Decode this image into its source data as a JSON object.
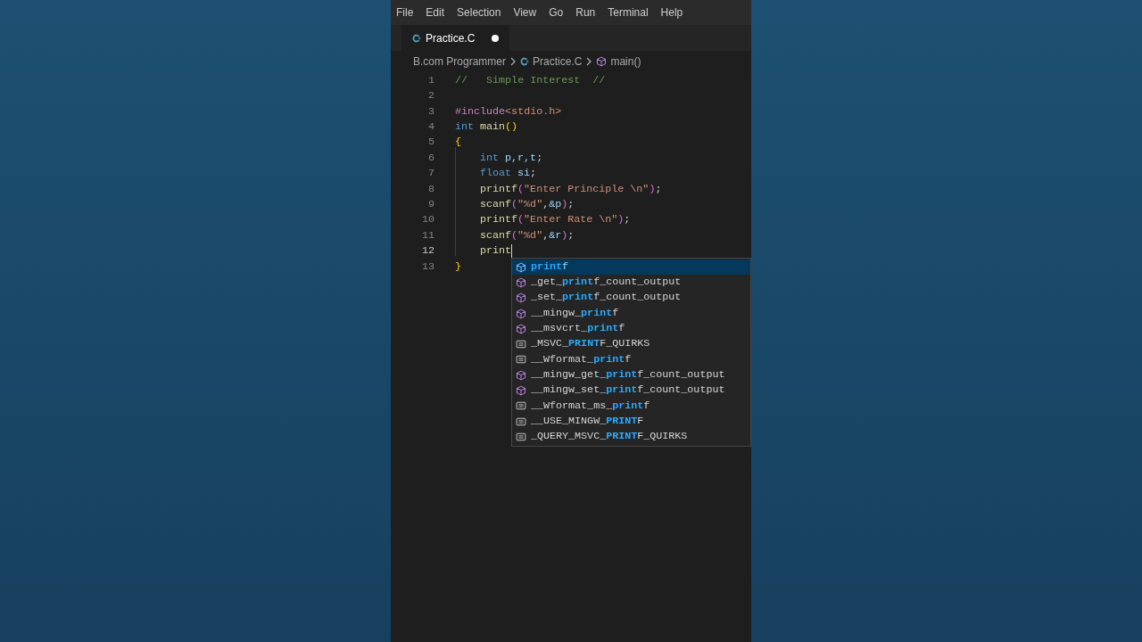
{
  "menu": [
    "File",
    "Edit",
    "Selection",
    "View",
    "Go",
    "Run",
    "Terminal",
    "Help"
  ],
  "tabs": [
    {
      "label": "Practice.C",
      "selected": true,
      "modified": true
    }
  ],
  "breadcrumb": [
    {
      "kind": "folder",
      "label": "B.com Programmer"
    },
    {
      "kind": "file",
      "label": "Practice.C"
    },
    {
      "kind": "symbol",
      "label": "main()"
    }
  ],
  "lines": [
    {
      "number": "1",
      "active": false,
      "indented": false,
      "tokens": [
        {
          "kind": "comment",
          "text": "//   Simple Interest  //"
        }
      ]
    },
    {
      "number": "2",
      "active": false
    },
    {
      "number": "3",
      "active": false,
      "indented": false,
      "tokens": [
        {
          "kind": "preproc",
          "text": "#include"
        },
        {
          "kind": "string",
          "text": "<stdio.h>"
        }
      ]
    },
    {
      "number": "4",
      "active": false,
      "indented": false,
      "tokens": [
        {
          "kind": "keyword",
          "text": "int"
        },
        {
          "kind": "function",
          "text": "main"
        },
        {
          "kind": "bracket",
          "text": "()"
        }
      ]
    },
    {
      "number": "5",
      "active": false,
      "indented": false,
      "tokens": [
        {
          "kind": "bracket",
          "text": "{"
        }
      ]
    },
    {
      "number": "6",
      "active": false,
      "indented": true,
      "tokens": [
        {
          "kind": "keyword",
          "text": "int"
        },
        {
          "kind": "variable",
          "text": "p,r,t"
        },
        {
          "kind": "plain",
          "text": ";"
        }
      ]
    },
    {
      "number": "7",
      "active": false,
      "indented": true,
      "tokens": [
        {
          "kind": "keyword",
          "text": "float"
        },
        {
          "kind": "variable",
          "text": "si"
        },
        {
          "kind": "plain",
          "text": ";"
        }
      ]
    },
    {
      "number": "8",
      "active": false,
      "indented": true,
      "tokens": [
        {
          "kind": "function",
          "text": "printf"
        },
        {
          "kind": "paren",
          "text": "("
        },
        {
          "kind": "string",
          "text": "\"Enter Principle \\n\""
        },
        {
          "kind": "paren",
          "text": ")"
        },
        {
          "kind": "plain",
          "text": ";"
        }
      ]
    },
    {
      "number": "9",
      "active": false,
      "indented": true,
      "tokens": [
        {
          "kind": "function",
          "text": "scanf"
        },
        {
          "kind": "paren",
          "text": "("
        },
        {
          "kind": "string",
          "text": "\"%d\""
        },
        {
          "kind": "plain",
          "text": ","
        },
        {
          "kind": "variable",
          "text": "&p"
        },
        {
          "kind": "paren",
          "text": ")"
        },
        {
          "kind": "plain",
          "text": ";"
        }
      ]
    },
    {
      "number": "10",
      "active": false,
      "indented": true,
      "tokens": [
        {
          "kind": "function",
          "text": "printf"
        },
        {
          "kind": "paren",
          "text": "("
        },
        {
          "kind": "string",
          "text": "\"Enter Rate \\n\""
        },
        {
          "kind": "paren",
          "text": ")"
        },
        {
          "kind": "plain",
          "text": ";"
        }
      ]
    },
    {
      "number": "11",
      "active": false,
      "indented": true,
      "tokens": [
        {
          "kind": "function",
          "text": "scanf"
        },
        {
          "kind": "paren",
          "text": "("
        },
        {
          "kind": "string",
          "text": "\"%d\""
        },
        {
          "kind": "plain",
          "text": ","
        },
        {
          "kind": "variable",
          "text": "&r"
        },
        {
          "kind": "paren",
          "text": ")"
        },
        {
          "kind": "plain",
          "text": ";"
        }
      ]
    },
    {
      "number": "12",
      "active": true,
      "indented": true,
      "tokens": [
        {
          "kind": "function",
          "text": "print"
        }
      ]
    },
    {
      "number": "13",
      "active": false,
      "indented": false,
      "tokens": [
        {
          "kind": "bracket",
          "text": "}"
        }
      ]
    }
  ],
  "suggestions": [
    {
      "kind": "function",
      "match": "print",
      "post": "f",
      "selected": true
    },
    {
      "kind": "function",
      "pre": "_get_",
      "match": "print",
      "post": "f_count_output",
      "selected": false
    },
    {
      "kind": "function",
      "pre": "_set_",
      "match": "print",
      "post": "f_count_output",
      "selected": false
    },
    {
      "kind": "function",
      "pre": "__mingw_",
      "match": "print",
      "post": "f",
      "selected": false
    },
    {
      "kind": "function",
      "pre": "__msvcrt_",
      "match": "print",
      "post": "f",
      "selected": false
    },
    {
      "kind": "constant",
      "pre": "_MSVC_",
      "match": "PRINT",
      "post": "F_QUIRKS",
      "selected": false
    },
    {
      "kind": "constant",
      "pre": "__Wformat_",
      "match": "print",
      "post": "f",
      "selected": false
    },
    {
      "kind": "function",
      "pre": "__mingw_get_",
      "match": "print",
      "post": "f_count_output",
      "selected": false
    },
    {
      "kind": "function",
      "pre": "__mingw_set_",
      "match": "print",
      "post": "f_count_output",
      "selected": false
    },
    {
      "kind": "constant",
      "pre": "__Wformat_ms_",
      "match": "print",
      "post": "f",
      "selected": false
    },
    {
      "kind": "constant",
      "pre": "__USE_MINGW_",
      "match": "PRINT",
      "post": "F",
      "selected": false
    },
    {
      "kind": "constant",
      "pre": "_QUERY_MSVC_",
      "match": "PRINT",
      "post": "F_QUIRKS",
      "selected": false
    }
  ]
}
